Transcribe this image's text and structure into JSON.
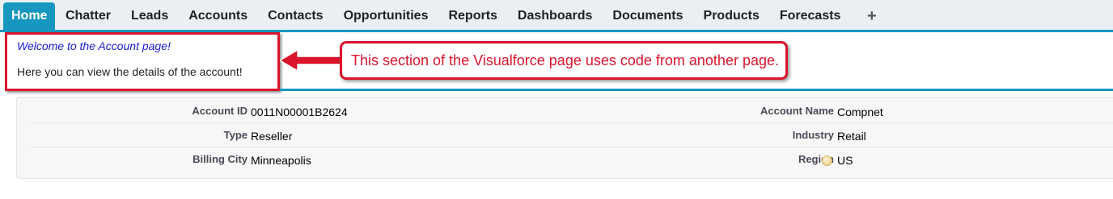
{
  "tabs": [
    {
      "label": "Home",
      "active": true
    },
    {
      "label": "Chatter"
    },
    {
      "label": "Leads"
    },
    {
      "label": "Accounts"
    },
    {
      "label": "Contacts"
    },
    {
      "label": "Opportunities"
    },
    {
      "label": "Reports"
    },
    {
      "label": "Dashboards"
    },
    {
      "label": "Documents"
    },
    {
      "label": "Products"
    },
    {
      "label": "Forecasts"
    }
  ],
  "add_tab_icon": "plus-icon",
  "add_tab_label": "+",
  "welcome": {
    "title": "Welcome to the Account page!",
    "subtitle": "Here you can view the details of the account!"
  },
  "callout": {
    "text": "This section of the Visualforce page uses code from another page."
  },
  "details": {
    "rows": [
      {
        "left_label": "Account ID",
        "left_value": "0011N00001B2624",
        "right_label": "Account Name",
        "right_value": "Compnet"
      },
      {
        "left_label": "Type",
        "left_value": "Reseller",
        "right_label": "Industry",
        "right_value": "Retail"
      },
      {
        "left_label": "Billing City",
        "left_value": "Minneapolis",
        "right_label": "Region",
        "right_value": "US"
      }
    ],
    "help_icon": "info-icon"
  },
  "colors": {
    "accent": "#1797c0",
    "annotation_red": "#d9142b",
    "welcome_blue": "#1b1bd6"
  }
}
